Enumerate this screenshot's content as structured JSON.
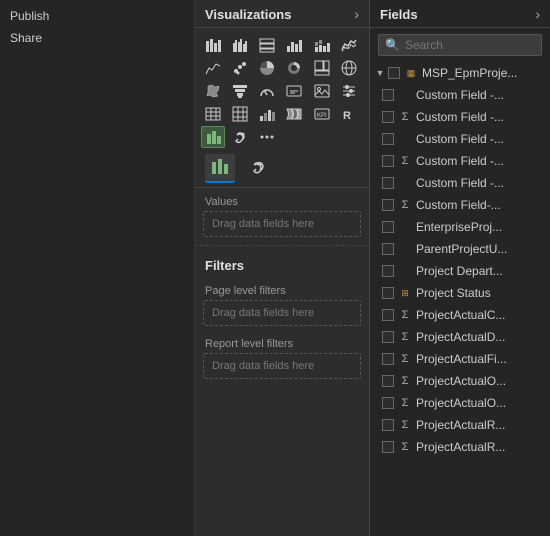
{
  "left_panel": {
    "buttons": [
      "Publish",
      "Share"
    ]
  },
  "viz_panel": {
    "title": "Visualizations",
    "chevron": "›",
    "tabs": [
      {
        "id": "bar-chart",
        "label": "Bar chart",
        "active": true
      },
      {
        "id": "link",
        "label": "Link",
        "active": false
      }
    ],
    "sections": {
      "values_label": "Values",
      "values_drop": "Drag data fields here",
      "filters_title": "Filters",
      "page_filters_label": "Page level filters",
      "page_drop": "Drag data fields here",
      "report_filters_label": "Report level filters",
      "report_drop": "Drag data fields here"
    }
  },
  "fields_panel": {
    "title": "Fields",
    "chevron": "›",
    "search_placeholder": "Search",
    "group": {
      "name": "MSP_EpmProje...",
      "icon": "table"
    },
    "items": [
      {
        "name": "Custom Field -...",
        "type": "checkbox",
        "indent": true
      },
      {
        "name": "Custom Field -...",
        "type": "sigma",
        "indent": true
      },
      {
        "name": "Custom Field -...",
        "type": "checkbox",
        "indent": true
      },
      {
        "name": "Custom Field -...",
        "type": "sigma",
        "indent": true
      },
      {
        "name": "Custom Field -...",
        "type": "checkbox",
        "indent": true
      },
      {
        "name": "Custom Field-...",
        "type": "sigma",
        "indent": true
      },
      {
        "name": "EnterpriseProj...",
        "type": "checkbox",
        "indent": true
      },
      {
        "name": "ParentProjectU...",
        "type": "checkbox",
        "indent": true
      },
      {
        "name": "Project Depart...",
        "type": "checkbox",
        "indent": true
      },
      {
        "name": "Project Status",
        "type": "hierarchy",
        "indent": true
      },
      {
        "name": "ProjectActualC...",
        "type": "sigma",
        "indent": true
      },
      {
        "name": "ProjectActualD...",
        "type": "sigma",
        "indent": true
      },
      {
        "name": "ProjectActualFi...",
        "type": "sigma",
        "indent": true
      },
      {
        "name": "ProjectActualO...",
        "type": "sigma",
        "indent": true
      },
      {
        "name": "ProjectActualO...",
        "type": "sigma",
        "indent": true
      },
      {
        "name": "ProjectActualR...",
        "type": "sigma",
        "indent": true
      },
      {
        "name": "ProjectActualR...",
        "type": "sigma",
        "indent": true
      }
    ]
  }
}
